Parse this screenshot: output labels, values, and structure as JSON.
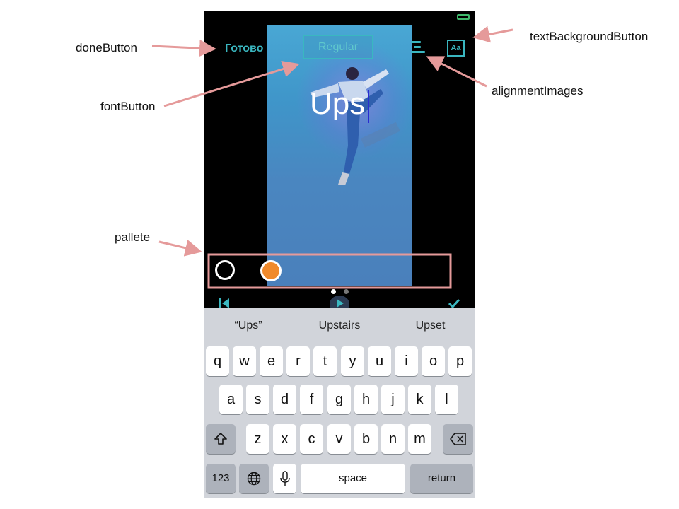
{
  "annotations": {
    "done_button": "doneButton",
    "font_button": "fontButton",
    "pallete": "pallete",
    "text_background_button": "textBackgroundButton",
    "alignment_images": "alignmentImages"
  },
  "editor": {
    "done_label": "Готово",
    "font_label": "Regular",
    "text_background_label": "Aa",
    "typed_text": "Ups"
  },
  "palette": {
    "colors": [
      "#ffffff",
      "#f08a2c"
    ]
  },
  "page_indicator": {
    "count": 2,
    "current": 1
  },
  "accent_color": "#3ab7c0",
  "annotation_color": "#e59a9a",
  "keyboard": {
    "suggestions": [
      "“Ups”",
      "Upstairs",
      "Upset"
    ],
    "row1": [
      "q",
      "w",
      "e",
      "r",
      "t",
      "y",
      "u",
      "i",
      "o",
      "p"
    ],
    "row2": [
      "a",
      "s",
      "d",
      "f",
      "g",
      "h",
      "j",
      "k",
      "l"
    ],
    "row3": [
      "z",
      "x",
      "c",
      "v",
      "b",
      "n",
      "m"
    ],
    "numbers_label": "123",
    "space_label": "space",
    "return_label": "return"
  }
}
